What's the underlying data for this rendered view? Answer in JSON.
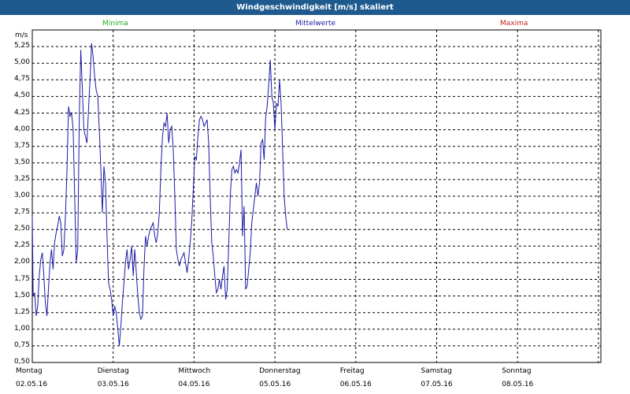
{
  "window": {
    "title": "Windgeschwindigkeit [m/s] skaliert"
  },
  "legend": {
    "min": "Minima",
    "avg": "Mittelwerte",
    "max": "Maxima"
  },
  "colors": {
    "titlebar": "#1e5a8e",
    "min": "#22aa22",
    "avg": "#1a1aa8",
    "max": "#c02020",
    "line": "#1a1aa8"
  },
  "chart_data": {
    "type": "line",
    "title": "Windgeschwindigkeit [m/s] skaliert",
    "unit": "m/s",
    "ylim": [
      0.5,
      5.5
    ],
    "y_ticks": [
      "0,50",
      "0,75",
      "1,00",
      "1,25",
      "1,50",
      "1,75",
      "2,00",
      "2,25",
      "2,50",
      "2,75",
      "3,00",
      "3,25",
      "3,50",
      "3,75",
      "4,00",
      "4,25",
      "4,50",
      "4,75",
      "5,00",
      "5,25"
    ],
    "x_ticks": [
      {
        "day": "Montag",
        "date": "02.05.16"
      },
      {
        "day": "Dienstag",
        "date": "03.05.16"
      },
      {
        "day": "Mittwoch",
        "date": "04.05.16"
      },
      {
        "day": "Donnerstag",
        "date": "05.05.16"
      },
      {
        "day": "Freitag",
        "date": "06.05.16"
      },
      {
        "day": "Samstag",
        "date": "07.05.16"
      },
      {
        "day": "Sonntag",
        "date": "08.05.16"
      }
    ],
    "grid": true,
    "series": [
      {
        "name": "Mittelwerte",
        "points": [
          [
            0.0,
            2.7
          ],
          [
            0.011,
            1.5
          ],
          [
            0.029,
            1.55
          ],
          [
            0.048,
            1.2
          ],
          [
            0.067,
            1.35
          ],
          [
            0.086,
            1.8
          ],
          [
            0.105,
            2.05
          ],
          [
            0.124,
            2.15
          ],
          [
            0.143,
            1.8
          ],
          [
            0.162,
            1.4
          ],
          [
            0.181,
            1.2
          ],
          [
            0.2,
            1.6
          ],
          [
            0.219,
            2.0
          ],
          [
            0.238,
            2.2
          ],
          [
            0.257,
            1.9
          ],
          [
            0.276,
            2.3
          ],
          [
            0.295,
            2.45
          ],
          [
            0.314,
            2.55
          ],
          [
            0.333,
            2.7
          ],
          [
            0.352,
            2.6
          ],
          [
            0.371,
            2.1
          ],
          [
            0.39,
            2.2
          ],
          [
            0.41,
            2.7
          ],
          [
            0.429,
            3.4
          ],
          [
            0.448,
            4.35
          ],
          [
            0.467,
            4.2
          ],
          [
            0.486,
            4.25
          ],
          [
            0.505,
            4.0
          ],
          [
            0.524,
            3.0
          ],
          [
            0.543,
            2.0
          ],
          [
            0.562,
            2.2
          ],
          [
            0.581,
            4.2
          ],
          [
            0.6,
            5.2
          ],
          [
            0.619,
            4.6
          ],
          [
            0.638,
            4.0
          ],
          [
            0.657,
            3.9
          ],
          [
            0.676,
            3.8
          ],
          [
            0.695,
            4.3
          ],
          [
            0.714,
            4.75
          ],
          [
            0.733,
            5.3
          ],
          [
            0.752,
            5.1
          ],
          [
            0.771,
            4.8
          ],
          [
            0.79,
            4.6
          ],
          [
            0.81,
            4.5
          ],
          [
            0.829,
            4.0
          ],
          [
            0.848,
            3.4
          ],
          [
            0.867,
            2.75
          ],
          [
            0.886,
            3.45
          ],
          [
            0.905,
            3.2
          ],
          [
            0.924,
            2.4
          ],
          [
            0.943,
            1.7
          ],
          [
            0.962,
            1.6
          ],
          [
            0.981,
            1.45
          ],
          [
            1.0,
            1.2
          ],
          [
            1.019,
            1.35
          ],
          [
            1.038,
            1.25
          ],
          [
            1.057,
            1.0
          ],
          [
            1.076,
            0.75
          ],
          [
            1.095,
            1.05
          ],
          [
            1.114,
            1.4
          ],
          [
            1.133,
            1.7
          ],
          [
            1.152,
            2.0
          ],
          [
            1.171,
            2.2
          ],
          [
            1.19,
            1.9
          ],
          [
            1.21,
            2.05
          ],
          [
            1.229,
            2.25
          ],
          [
            1.248,
            1.8
          ],
          [
            1.267,
            2.2
          ],
          [
            1.286,
            1.85
          ],
          [
            1.305,
            1.5
          ],
          [
            1.324,
            1.25
          ],
          [
            1.343,
            1.15
          ],
          [
            1.362,
            1.2
          ],
          [
            1.381,
            1.9
          ],
          [
            1.4,
            2.4
          ],
          [
            1.419,
            2.25
          ],
          [
            1.438,
            2.4
          ],
          [
            1.457,
            2.5
          ],
          [
            1.476,
            2.55
          ],
          [
            1.495,
            2.6
          ],
          [
            1.514,
            2.4
          ],
          [
            1.533,
            2.3
          ],
          [
            1.552,
            2.45
          ],
          [
            1.571,
            2.75
          ],
          [
            1.59,
            3.4
          ],
          [
            1.61,
            3.9
          ],
          [
            1.629,
            4.1
          ],
          [
            1.648,
            4.05
          ],
          [
            1.667,
            4.25
          ],
          [
            1.686,
            3.8
          ],
          [
            1.705,
            4.0
          ],
          [
            1.724,
            4.05
          ],
          [
            1.743,
            3.7
          ],
          [
            1.762,
            3.0
          ],
          [
            1.781,
            2.2
          ],
          [
            1.8,
            2.05
          ],
          [
            1.819,
            1.95
          ],
          [
            1.838,
            2.05
          ],
          [
            1.857,
            2.1
          ],
          [
            1.876,
            2.15
          ],
          [
            1.895,
            2.0
          ],
          [
            1.914,
            1.85
          ],
          [
            1.933,
            2.05
          ],
          [
            1.952,
            2.3
          ],
          [
            1.971,
            2.6
          ],
          [
            1.99,
            3.1
          ],
          [
            2.01,
            3.6
          ],
          [
            2.029,
            3.55
          ],
          [
            2.048,
            3.9
          ],
          [
            2.067,
            4.15
          ],
          [
            2.086,
            4.2
          ],
          [
            2.105,
            4.15
          ],
          [
            2.124,
            4.05
          ],
          [
            2.143,
            4.1
          ],
          [
            2.162,
            4.15
          ],
          [
            2.181,
            3.8
          ],
          [
            2.2,
            3.0
          ],
          [
            2.219,
            2.3
          ],
          [
            2.238,
            2.1
          ],
          [
            2.257,
            1.8
          ],
          [
            2.276,
            1.55
          ],
          [
            2.295,
            1.6
          ],
          [
            2.314,
            1.75
          ],
          [
            2.333,
            1.6
          ],
          [
            2.352,
            1.8
          ],
          [
            2.371,
            1.95
          ],
          [
            2.39,
            1.45
          ],
          [
            2.41,
            1.6
          ],
          [
            2.429,
            2.3
          ],
          [
            2.448,
            3.0
          ],
          [
            2.467,
            3.4
          ],
          [
            2.486,
            3.45
          ],
          [
            2.505,
            3.35
          ],
          [
            2.524,
            3.4
          ],
          [
            2.543,
            3.35
          ],
          [
            2.562,
            3.5
          ],
          [
            2.581,
            3.7
          ],
          [
            2.6,
            2.4
          ],
          [
            2.619,
            2.85
          ],
          [
            2.638,
            1.6
          ],
          [
            2.657,
            1.65
          ],
          [
            2.676,
            1.9
          ],
          [
            2.695,
            2.15
          ],
          [
            2.714,
            2.6
          ],
          [
            2.733,
            2.8
          ],
          [
            2.752,
            3.0
          ],
          [
            2.771,
            3.2
          ],
          [
            2.79,
            3.0
          ],
          [
            2.81,
            3.2
          ],
          [
            2.829,
            3.8
          ],
          [
            2.848,
            3.85
          ],
          [
            2.867,
            3.55
          ],
          [
            2.886,
            4.2
          ],
          [
            2.905,
            4.35
          ],
          [
            2.924,
            4.7
          ],
          [
            2.943,
            5.05
          ],
          [
            2.962,
            4.5
          ],
          [
            2.981,
            4.4
          ],
          [
            3.0,
            4.0
          ],
          [
            3.019,
            4.4
          ],
          [
            3.038,
            4.35
          ],
          [
            3.057,
            4.75
          ],
          [
            3.076,
            4.4
          ],
          [
            3.095,
            3.7
          ],
          [
            3.114,
            3.0
          ],
          [
            3.133,
            2.7
          ],
          [
            3.152,
            2.5
          ]
        ]
      }
    ]
  }
}
